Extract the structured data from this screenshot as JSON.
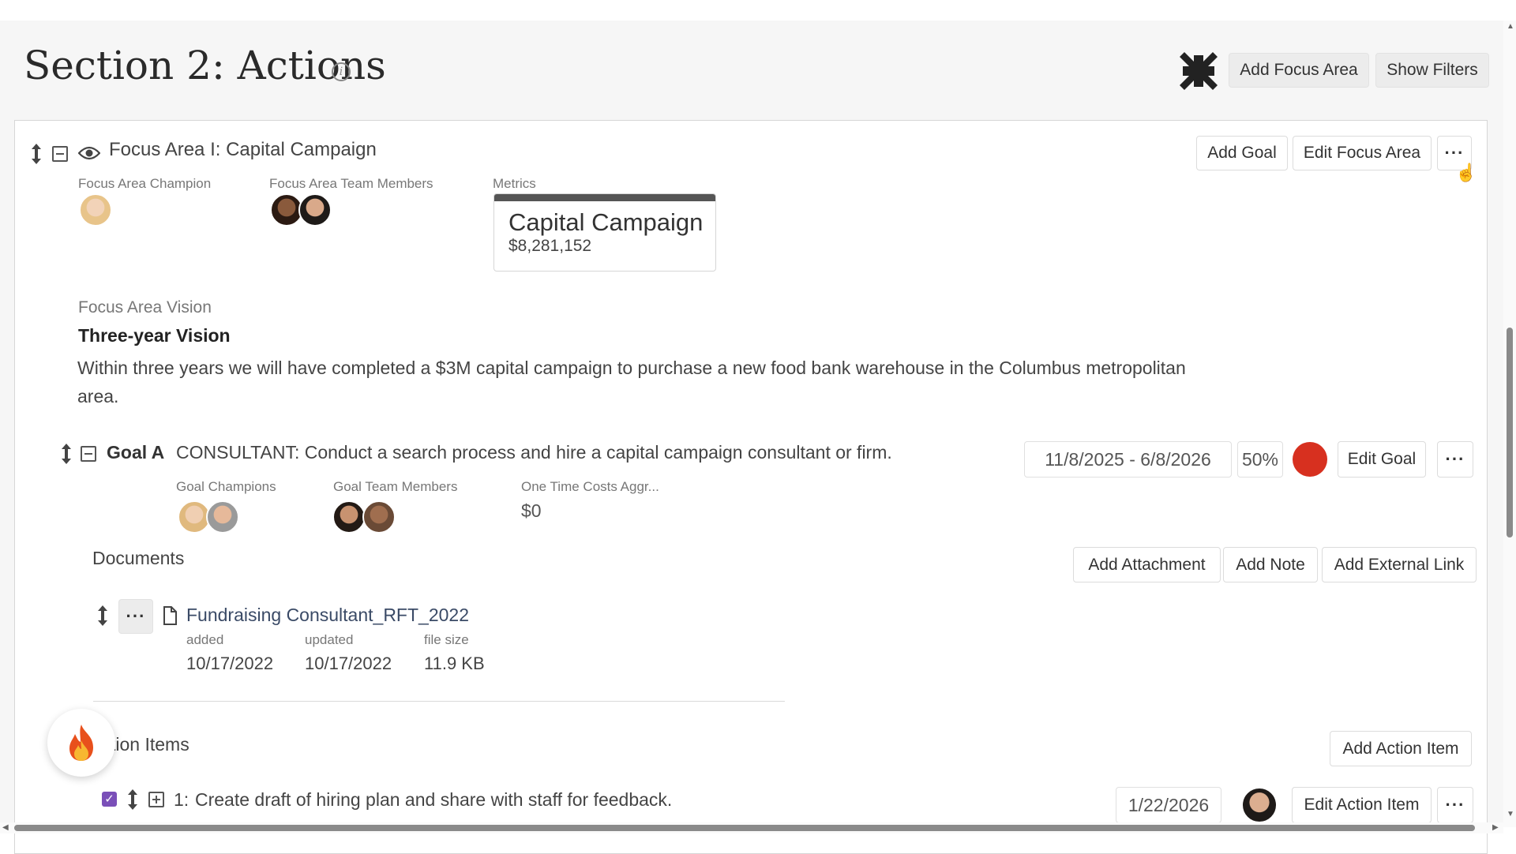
{
  "section": {
    "title": "Section 2: Actions",
    "buttons": {
      "add_focus_area": "Add Focus Area",
      "show_filters": "Show Filters"
    }
  },
  "focus_area": {
    "title": "Focus Area I: Capital Campaign",
    "buttons": {
      "add_goal": "Add Goal",
      "edit_focus_area": "Edit Focus Area",
      "more": "···"
    },
    "champion_label": "Focus Area Champion",
    "team_label": "Focus Area Team Members",
    "metrics_label": "Metrics",
    "metric": {
      "title": "Capital Campaign",
      "value": "$8,281,152"
    },
    "vision_label": "Focus Area Vision",
    "vision_heading": "Three-year Vision",
    "vision_text": "Within three years we will have completed a $3M capital campaign to purchase a new food bank warehouse in the Columbus metropolitan area."
  },
  "goal": {
    "label": "Goal A",
    "text": "CONSULTANT: Conduct a search process and hire a capital campaign consultant or firm.",
    "date_range": "11/8/2025 - 6/8/2026",
    "progress": "50%",
    "status_color": "#d7301f",
    "edit_label": "Edit Goal",
    "more": "···",
    "champions_label": "Goal Champions",
    "team_label": "Goal Team Members",
    "costs_label": "One Time Costs Aggr...",
    "costs_value": "$0"
  },
  "documents": {
    "heading": "Documents",
    "buttons": {
      "add_attachment": "Add Attachment",
      "add_note": "Add Note",
      "add_external_link": "Add External Link"
    },
    "more": "···",
    "items": [
      {
        "name": "Fundraising Consultant_RFT_2022",
        "added_label": "added",
        "added": "10/17/2022",
        "updated_label": "updated",
        "updated": "10/17/2022",
        "size_label": "file size",
        "size": "11.9 KB"
      }
    ]
  },
  "action_items": {
    "heading": "tion Items",
    "add_label": "Add Action Item",
    "items": [
      {
        "number": "1:",
        "text": "Create draft of hiring plan and share with staff for feedback.",
        "date": "1/22/2026",
        "edit_label": "Edit Action Item",
        "more": "···",
        "checked": true
      }
    ]
  },
  "colors": {
    "accent_purple": "#7a4fb8",
    "status_red": "#d7301f",
    "metric_bar": "#555555"
  },
  "icons": [
    "info-icon",
    "compress-icon",
    "move-icon",
    "collapse-icon",
    "eye-icon",
    "document-icon",
    "expand-icon",
    "fire-icon",
    "checkbox-icon"
  ]
}
